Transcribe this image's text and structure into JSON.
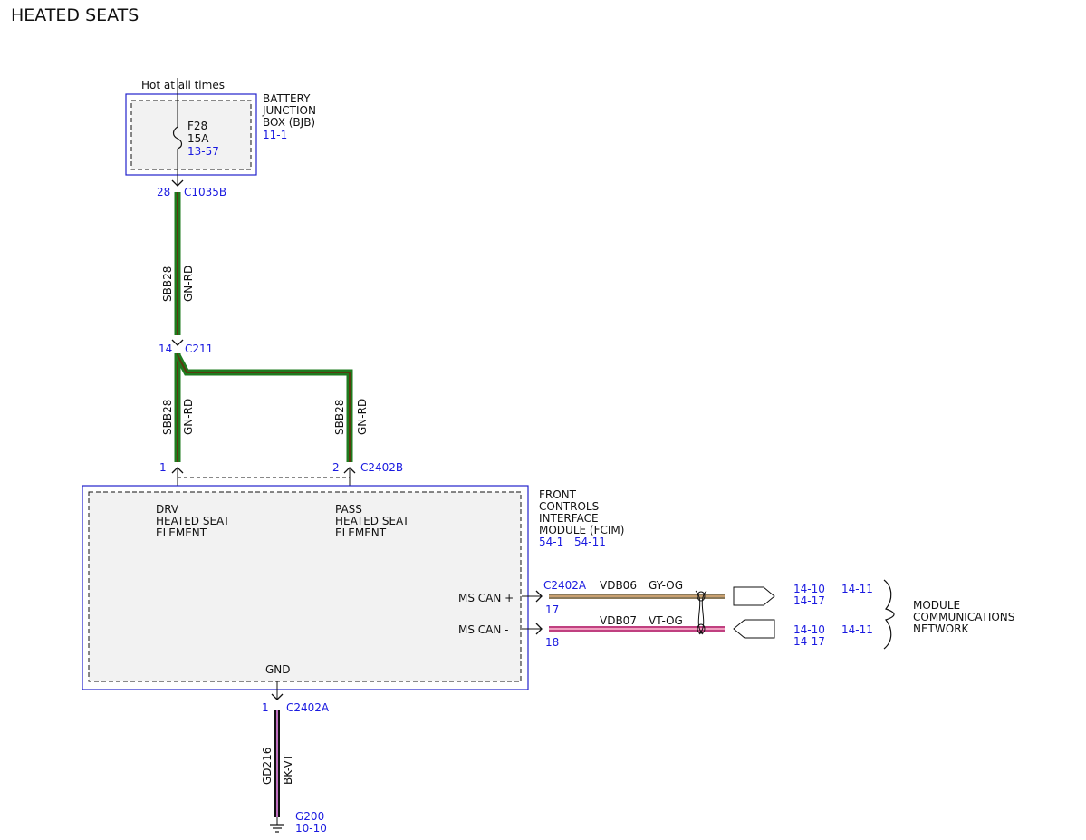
{
  "title": "HEATED SEATS",
  "colors": {
    "module_border": "#2222cc",
    "module_fill": "#f2f2f2",
    "ref_text": "#1a1ae0",
    "wire_gn_rd_outer": "#1e7b1e",
    "wire_gn_rd_inner": "#5a3a10",
    "wire_gy_og_outer": "#8a7a5c",
    "wire_gy_og_inner": "#c9a070",
    "wire_vt_og_outer": "#c04080",
    "wire_vt_og_inner": "#f0a0c0",
    "wire_bk_vt_outer": "#111111",
    "wire_bk_vt_inner": "#c070c0"
  },
  "bjb": {
    "hot_label": "Hot at all times",
    "name_lines": [
      "BATTERY",
      "JUNCTION",
      "BOX (BJB)"
    ],
    "ref": "11-1",
    "fuse_id": "F28",
    "fuse_rating": "15A",
    "fuse_ref": "13-57"
  },
  "connectors": {
    "c1035b": {
      "pin": "28",
      "name": "C1035B"
    },
    "c211": {
      "pin": "14",
      "name": "C211"
    },
    "c2402b_drv_pin": "1",
    "c2402b_pass_pin": "2",
    "c2402b_name": "C2402B",
    "c2402a_can_name": "C2402A",
    "can_plus_pin": "17",
    "can_minus_pin": "18",
    "gnd_pin": "1",
    "gnd_name": "C2402A"
  },
  "wires": {
    "feed_circuit": "SBB28",
    "feed_color": "GN-RD",
    "drv_circuit": "SBB28",
    "drv_color": "GN-RD",
    "pass_circuit": "SBB28",
    "pass_color": "GN-RD",
    "can_plus_circuit": "VDB06",
    "can_plus_color": "GY-OG",
    "can_minus_circuit": "VDB07",
    "can_minus_color": "VT-OG",
    "gnd_circuit": "GD216",
    "gnd_color": "BK-VT"
  },
  "fcim": {
    "name_lines": [
      "FRONT",
      "CONTROLS",
      "INTERFACE",
      "MODULE (FCIM)"
    ],
    "ref_a": "54-1",
    "ref_b": "54-11",
    "drv_lines": [
      "DRV",
      "HEATED SEAT",
      "ELEMENT"
    ],
    "pass_lines": [
      "PASS",
      "HEATED SEAT",
      "ELEMENT"
    ],
    "can_plus_label": "MS CAN +",
    "can_minus_label": "MS CAN -",
    "gnd_label": "GND"
  },
  "network": {
    "plus_ref_a": "14-10",
    "plus_ref_b": "14-17",
    "plus_ref_c": "14-11",
    "minus_ref_a": "14-10",
    "minus_ref_b": "14-17",
    "minus_ref_c": "14-11",
    "name_lines": [
      "MODULE",
      "COMMUNICATIONS",
      "NETWORK"
    ]
  },
  "ground": {
    "name": "G200",
    "ref": "10-10"
  }
}
